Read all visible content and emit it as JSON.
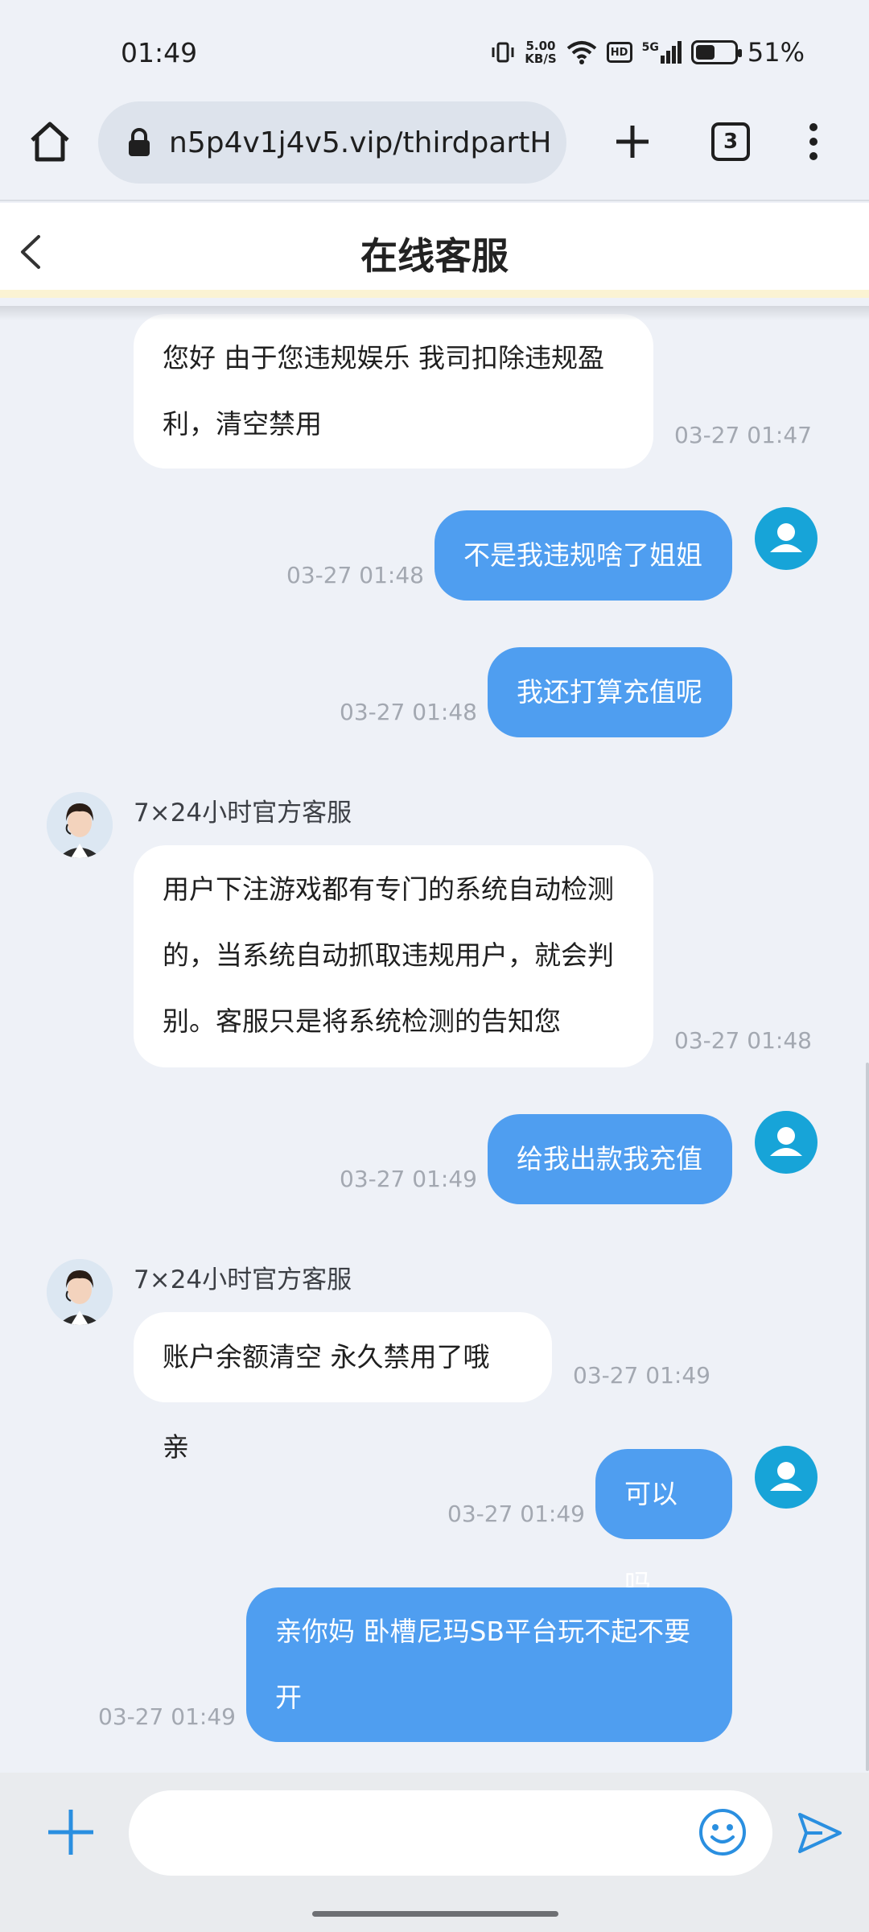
{
  "status_bar": {
    "time": "01:49",
    "net_speed_value": "5.00",
    "net_speed_unit": "KB/S",
    "hd_label": "HD",
    "signal_label": "5G",
    "battery_percent_text": "51%",
    "battery_level": 0.51
  },
  "browser": {
    "url": "n5p4v1j4v5.vip/thirdpartH",
    "tab_count": "3"
  },
  "header": {
    "title": "在线客服"
  },
  "messages": [
    {
      "side": "in",
      "lines": [
        "您好 由于您违规娱乐 我司扣除违规盈",
        "利，清空禁用"
      ],
      "time": "03-27 01:47"
    },
    {
      "side": "out",
      "lines": [
        "不是我违规啥了姐姐"
      ],
      "time": "03-27 01:48"
    },
    {
      "side": "out",
      "lines": [
        "我还打算充值呢"
      ],
      "time": "03-27 01:48"
    },
    {
      "side": "in",
      "sender": "7×24小时官方客服",
      "lines": [
        "用户下注游戏都有专门的系统自动检测",
        "的，当系统自动抓取违规用户，就会判",
        "别。客服只是将系统检测的告知您"
      ],
      "time": "03-27 01:48"
    },
    {
      "side": "out",
      "lines": [
        "给我出款我充值"
      ],
      "time": "03-27 01:49"
    },
    {
      "side": "in",
      "sender": "7×24小时官方客服",
      "lines": [
        "账户余额清空 永久禁用了哦 亲"
      ],
      "time": "03-27 01:49"
    },
    {
      "side": "out",
      "lines": [
        "可以吗"
      ],
      "time": "03-27 01:49"
    },
    {
      "side": "out",
      "lines": [
        "亲你妈 卧槽尼玛SB平台玩不起不要",
        "开"
      ],
      "time": "03-27 01:49"
    }
  ],
  "input": {
    "placeholder": ""
  },
  "colors": {
    "outgoing_bubble": "#4f9ef0",
    "incoming_bubble": "#ffffff",
    "accent_icons": "#2a8fe0",
    "user_avatar": "#17a4d8"
  },
  "icons": [
    "home-icon",
    "lock-icon",
    "plus-icon",
    "tabs-icon",
    "more-icon",
    "back-icon",
    "user-icon",
    "agent-avatar",
    "emoji-icon",
    "send-icon"
  ]
}
